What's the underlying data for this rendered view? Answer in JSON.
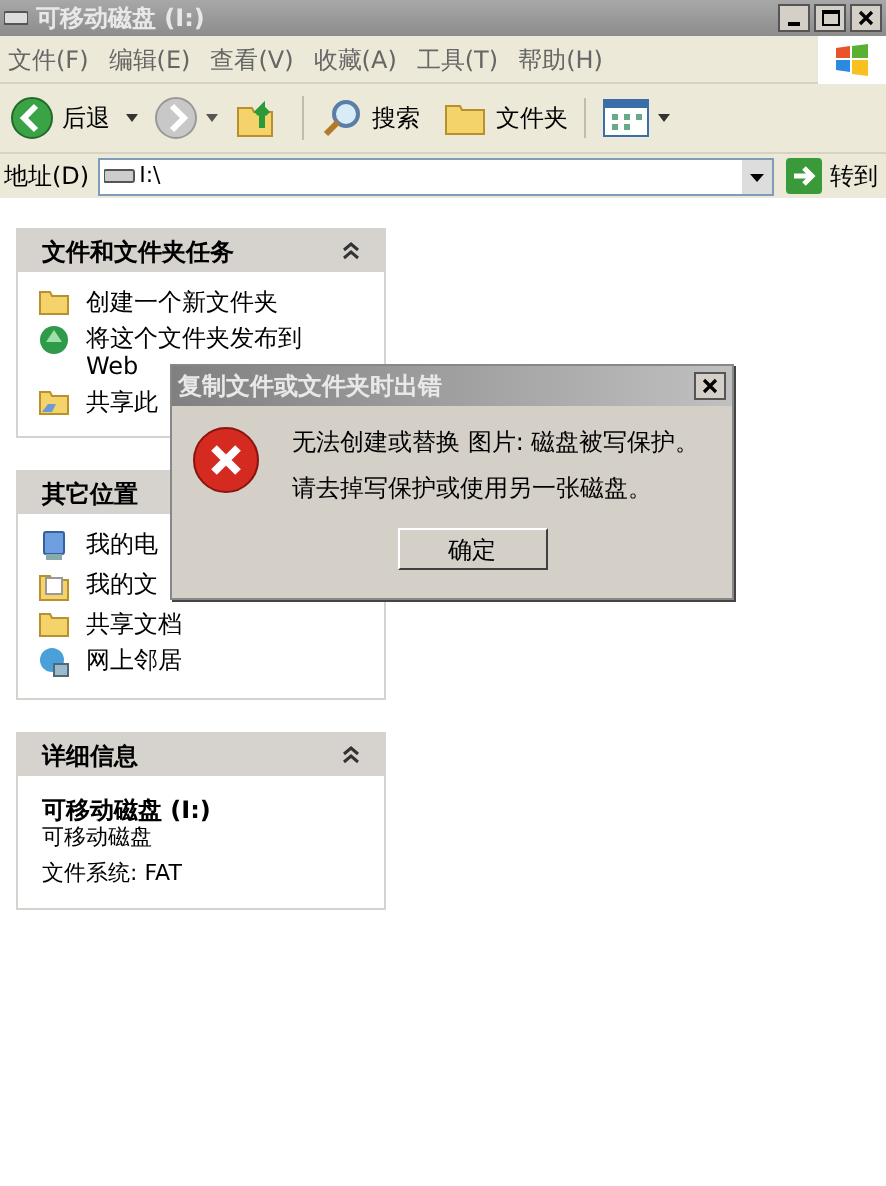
{
  "window": {
    "title": "可移动磁盘 (I:)"
  },
  "menu": [
    "文件(F)",
    "编辑(E)",
    "查看(V)",
    "收藏(A)",
    "工具(T)",
    "帮助(H)"
  ],
  "toolbar": [
    {
      "kind": "back",
      "label": "后退"
    },
    {
      "kind": "forward"
    },
    {
      "kind": "up"
    },
    {
      "kind": "search",
      "label": "搜索"
    },
    {
      "kind": "folders",
      "label": "文件夹"
    },
    {
      "kind": "views"
    }
  ],
  "address": {
    "label": "地址(D)",
    "value": "I:\\",
    "go": "转到"
  },
  "panels": [
    {
      "title": "文件和文件夹任务",
      "collapse_button": true,
      "items": [
        {
          "kind": "new-folder",
          "label": "创建一个新文件夹"
        },
        {
          "kind": "publish",
          "label": "将这个文件夹发布到 Web"
        },
        {
          "kind": "share",
          "label": "共享此"
        }
      ]
    },
    {
      "title": "其它位置",
      "items": [
        {
          "kind": "computer",
          "label": "我的电"
        },
        {
          "kind": "documents",
          "label": "我的文"
        },
        {
          "kind": "folder",
          "label": "共享文档"
        },
        {
          "kind": "network",
          "label": "网上邻居"
        }
      ]
    },
    {
      "title": "详细信息",
      "collapse_button": true,
      "details": {
        "name": "可移动磁盘 (I:)",
        "type": "可移动磁盘",
        "filesystem": "文件系统: FAT"
      }
    }
  ],
  "dialog": {
    "title": "复制文件或文件夹时出错",
    "lines": [
      "无法创建或替换 图片: 磁盘被写保护。",
      "请去掉写保护或使用另一张磁盘。"
    ],
    "button": "确定"
  }
}
